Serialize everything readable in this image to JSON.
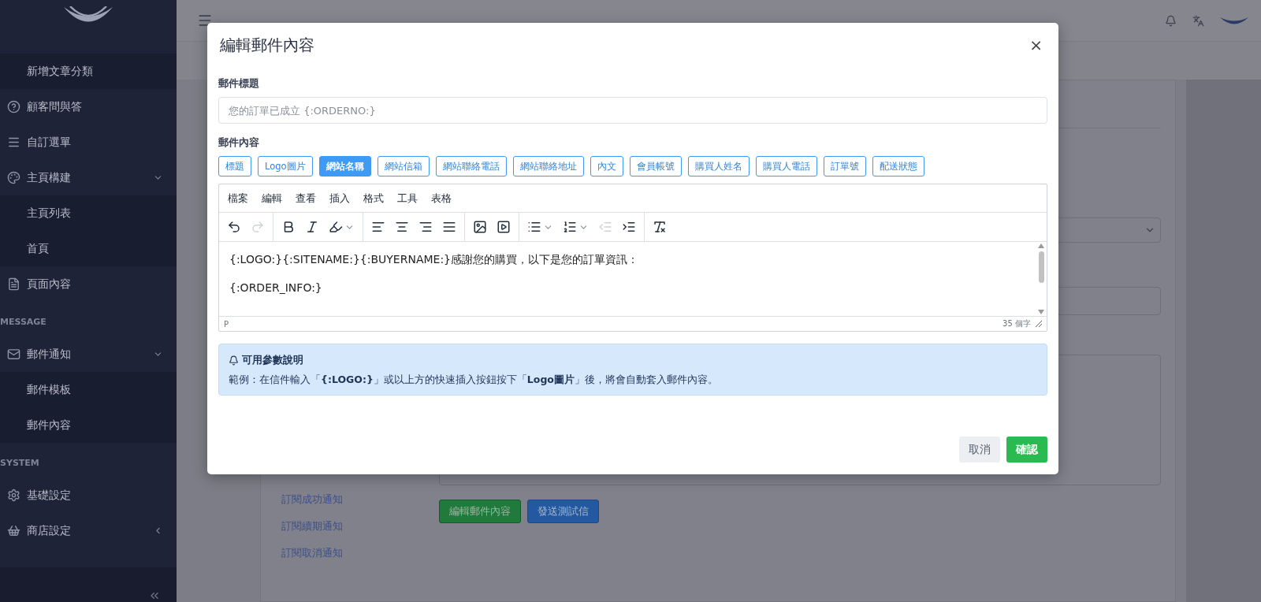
{
  "sidebar": {
    "groups": [
      {
        "items": [
          {
            "label": "新增文章分類",
            "kind": "sub"
          },
          {
            "label": "顧客問與答",
            "kind": "help"
          },
          {
            "label": "自訂選單",
            "kind": "menu"
          },
          {
            "label": "主頁構建",
            "kind": "palette",
            "expanded": true,
            "children": [
              {
                "label": "主頁列表"
              },
              {
                "label": "首頁"
              }
            ]
          },
          {
            "label": "頁面內容",
            "kind": "file"
          }
        ]
      },
      {
        "heading": "MESSAGE",
        "items": [
          {
            "label": "郵件通知",
            "kind": "mail",
            "expanded": true,
            "children": [
              {
                "label": "郵件模板"
              },
              {
                "label": "郵件內容"
              }
            ]
          }
        ]
      },
      {
        "heading": "SYSTEM",
        "items": [
          {
            "label": "基礎設定",
            "kind": "gear"
          },
          {
            "label": "商店設定",
            "kind": "basket",
            "expanded": false
          }
        ]
      }
    ]
  },
  "page": {
    "notice_list": [
      "訂閱成功通知",
      "訂閱續期通知",
      "訂閱取消通知"
    ],
    "buttons": [
      {
        "label": "編輯郵件內容",
        "kind": "success"
      },
      {
        "label": "發送測試信",
        "kind": "primary"
      }
    ]
  },
  "modal": {
    "title": "編輯郵件內容",
    "close": "×",
    "subject": {
      "label": "郵件標題",
      "placeholder": "您的訂單已成立 {:ORDERNO:}"
    },
    "body_label": "郵件內容",
    "insert_tags": [
      {
        "label": "標題",
        "selected": false
      },
      {
        "label": "Logo圖片",
        "selected": false
      },
      {
        "label": "網站名稱",
        "selected": true
      },
      {
        "label": "網站信箱",
        "selected": false
      },
      {
        "label": "網站聯絡電話",
        "selected": false
      },
      {
        "label": "網站聯絡地址",
        "selected": false
      },
      {
        "label": "內文",
        "selected": false
      },
      {
        "label": "會員帳號",
        "selected": false
      },
      {
        "label": "購買人姓名",
        "selected": false
      },
      {
        "label": "購買人電話",
        "selected": false
      },
      {
        "label": "訂單號",
        "selected": false
      },
      {
        "label": "配送狀態",
        "selected": false
      }
    ],
    "editor": {
      "menubar": [
        "檔案",
        "編輯",
        "查看",
        "插入",
        "格式",
        "工具",
        "表格"
      ],
      "toolbar": [
        [
          {
            "kind": "undo",
            "disabled": false
          },
          {
            "kind": "redo",
            "disabled": true
          }
        ],
        [
          {
            "kind": "bold",
            "disabled": false
          },
          {
            "kind": "italic",
            "disabled": false
          },
          {
            "kind": "highlight",
            "disabled": false
          }
        ],
        [
          {
            "kind": "align-left",
            "disabled": false
          },
          {
            "kind": "align-center",
            "disabled": false
          },
          {
            "kind": "align-right",
            "disabled": false
          },
          {
            "kind": "align-justify",
            "disabled": false
          }
        ],
        [
          {
            "kind": "image",
            "disabled": false
          },
          {
            "kind": "media",
            "disabled": false
          }
        ],
        [
          {
            "kind": "bullet-list",
            "disabled": false
          },
          {
            "kind": "number-list",
            "disabled": false
          },
          {
            "kind": "outdent",
            "disabled": true
          },
          {
            "kind": "indent",
            "disabled": false
          }
        ],
        [
          {
            "kind": "clear-format",
            "disabled": false
          }
        ]
      ],
      "paragraphs": [
        "{:LOGO:}{:SITENAME:}{:BUYERNAME:}感謝您的購買，以下是您的訂單資訊：",
        "{:ORDER_INFO:}"
      ],
      "path": "P",
      "word_count": "35 個字"
    },
    "alert": {
      "title": "可用參數說明",
      "text": "範例：在信件輸入「**{:LOGO:}**」或以上方的快速插入按鈕按下「**Logo圖片**」後，將會自動套入郵件內容。"
    },
    "buttons": [
      {
        "label": "取消",
        "kind": "secondary"
      },
      {
        "label": "確認",
        "kind": "success"
      }
    ]
  }
}
